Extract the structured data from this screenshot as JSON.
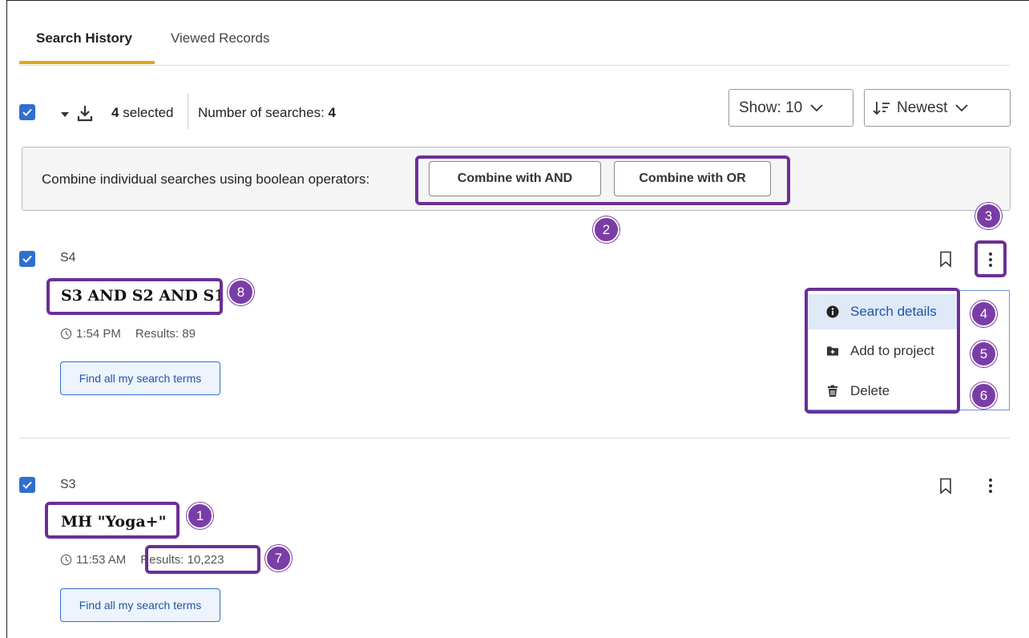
{
  "tabs": [
    {
      "label": "Search History",
      "active": true
    },
    {
      "label": "Viewed Records",
      "active": false
    }
  ],
  "toolbar": {
    "selected_count": "4",
    "selected_suffix": " selected",
    "num_searches_label": "Number of searches: ",
    "num_searches_value": "4",
    "show_label": "Show: 10",
    "sort_label": "Newest"
  },
  "combine": {
    "label": "Combine individual searches using boolean operators:",
    "and_label": "Combine with AND",
    "or_label": "Combine with OR"
  },
  "records": [
    {
      "id": "S4",
      "query": "S3 AND S2 AND S1",
      "time": "1:54 PM",
      "results": "Results: 89",
      "find_label": "Find all my search terms",
      "checked": true
    },
    {
      "id": "S3",
      "query": "MH \"Yoga+\"",
      "time": "11:53 AM",
      "results": "Results: 10,223",
      "find_label": "Find all my search terms",
      "checked": true
    }
  ],
  "menu": {
    "items": [
      {
        "label": "Search details",
        "icon": "info-icon",
        "highlighted": true
      },
      {
        "label": "Add to project",
        "icon": "folder-plus-icon"
      },
      {
        "label": "Delete",
        "icon": "trash-icon"
      }
    ]
  },
  "badges": [
    "1",
    "2",
    "3",
    "4",
    "5",
    "6",
    "7",
    "8"
  ],
  "colors": {
    "accent": "#e8a317",
    "checkbox": "#2f6fcf",
    "annotation": "#6b2f96",
    "badge": "#7a3da6"
  }
}
